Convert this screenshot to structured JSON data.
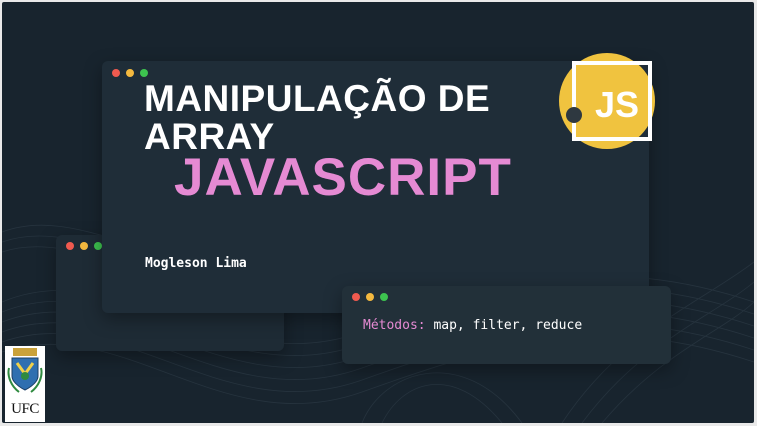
{
  "slide": {
    "title": "MANIPULAÇÃO DE ARRAY",
    "subtitle": "JAVASCRIPT",
    "author": "Mogleson Lima",
    "methods_keyword": "Métodos:",
    "methods_list": " map, filter, reduce"
  },
  "logos": {
    "js_text": "JS",
    "ufc_text": "UFC"
  },
  "colors": {
    "background": "#18242e",
    "window": "#1f2d38",
    "accent_pink": "#e58ad3",
    "js_yellow": "#f0c33f",
    "dot_red": "#f05a4f",
    "dot_yellow": "#f4b93f",
    "dot_green": "#3dc34f"
  }
}
